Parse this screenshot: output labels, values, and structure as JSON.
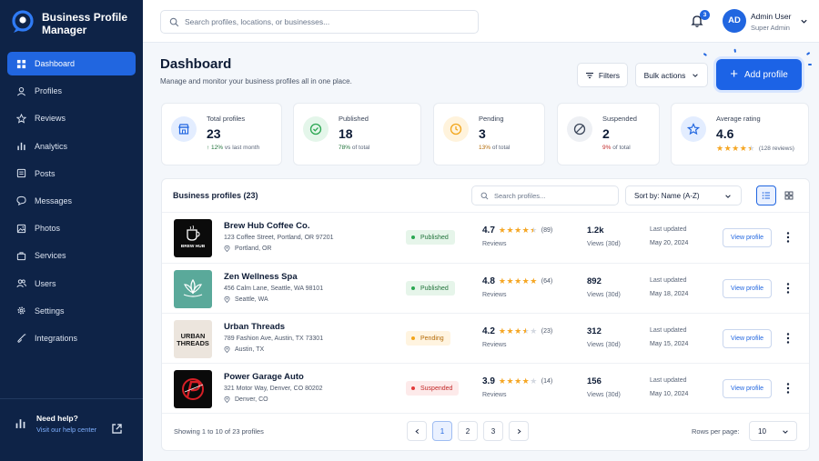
{
  "app": {
    "title": "Business Profile Manager"
  },
  "sidebar": {
    "items": [
      {
        "label": "Dashboard",
        "icon": "dashboard-icon",
        "active": true
      },
      {
        "label": "Profiles",
        "icon": "profiles-icon"
      },
      {
        "label": "Reviews",
        "icon": "star-icon"
      },
      {
        "label": "Analytics",
        "icon": "analytics-icon"
      },
      {
        "label": "Posts",
        "icon": "posts-icon"
      },
      {
        "label": "Messages",
        "icon": "messages-icon"
      },
      {
        "label": "Photos",
        "icon": "photos-icon"
      },
      {
        "label": "Services",
        "icon": "services-icon"
      },
      {
        "label": "Users",
        "icon": "users-icon"
      },
      {
        "label": "Settings",
        "icon": "settings-icon"
      },
      {
        "label": "Integrations",
        "icon": "integrations-icon"
      }
    ],
    "help": {
      "title": "Need help?",
      "link": "Visit our help center"
    }
  },
  "topbar": {
    "search_placeholder": "Search profiles, locations, or businesses...",
    "notifications_count": "3",
    "user": {
      "initials": "AD",
      "name": "Admin User",
      "role": "Super Admin"
    }
  },
  "header": {
    "title": "Dashboard",
    "subtitle": "Manage and monitor your business profiles all in one place.",
    "filters_label": "Filters",
    "bulk_label": "Bulk actions",
    "add_label": "Add profile"
  },
  "stats": {
    "total": {
      "label": "Total profiles",
      "value": "23",
      "change": "↑ 12%",
      "sub": "vs last month"
    },
    "published": {
      "label": "Published",
      "value": "18",
      "pct": "78%",
      "sub": "of total"
    },
    "pending": {
      "label": "Pending",
      "value": "3",
      "pct": "13%",
      "sub": "of total"
    },
    "suspended": {
      "label": "Suspended",
      "value": "2",
      "pct": "9%",
      "sub": "of total"
    },
    "rating": {
      "label": "Average rating",
      "value": "4.6",
      "count": "(128 reviews)",
      "stars": 4.5
    }
  },
  "table": {
    "title": "Business profiles (23)",
    "search_placeholder": "Search profiles...",
    "sort_label": "Sort by: Name (A-Z)",
    "rows": [
      {
        "name": "Brew Hub Coffee Co.",
        "address": "123 Coffee Street, Portland, OR 97201",
        "city": "Portland, OR",
        "status": "Published",
        "rating": "4.7",
        "stars": 4.5,
        "reviews_count": "(89)",
        "rating_label": "Reviews",
        "views": "1.2k",
        "views_label": "Views (30d)",
        "updated_label": "Last updated",
        "updated": "May 20, 2024",
        "action": "View profile",
        "logo": "brew-hub-logo",
        "logo_text": "BREW HUB"
      },
      {
        "name": "Zen Wellness Spa",
        "address": "456 Calm Lane, Seattle, WA 98101",
        "city": "Seattle, WA",
        "status": "Published",
        "rating": "4.8",
        "stars": 5,
        "reviews_count": "(64)",
        "rating_label": "Reviews",
        "views": "892",
        "views_label": "Views (30d)",
        "updated_label": "Last updated",
        "updated": "May 18, 2024",
        "action": "View profile",
        "logo": "lotus-logo"
      },
      {
        "name": "Urban Threads",
        "address": "789 Fashion Ave, Austin, TX 73301",
        "city": "Austin, TX",
        "status": "Pending",
        "rating": "4.2",
        "stars": 3.5,
        "reviews_count": "(23)",
        "rating_label": "Reviews",
        "views": "312",
        "views_label": "Views (30d)",
        "updated_label": "Last updated",
        "updated": "May 15, 2024",
        "action": "View profile",
        "logo": "urban-threads-logo",
        "logo_text": "URBAN THREADS"
      },
      {
        "name": "Power Garage Auto",
        "address": "321 Motor Way, Denver, CO 80202",
        "city": "Denver, CO",
        "status": "Suspended",
        "rating": "3.9",
        "stars": 4,
        "reviews_count": "(14)",
        "rating_label": "Reviews",
        "views": "156",
        "views_label": "Views (30d)",
        "updated_label": "Last updated",
        "updated": "May 10, 2024",
        "action": "View profile",
        "logo": "power-garage-logo"
      }
    ],
    "showing": "Showing 1 to 10 of 23 profiles",
    "pages": [
      "1",
      "2",
      "3"
    ],
    "rows_per_page_label": "Rows per page:",
    "rows_per_page": "10"
  },
  "colors": {
    "sidebar": "#0e2347",
    "accent": "#2166e0",
    "star": "#f5a623",
    "published": "#2aa651",
    "pending": "#f2a51a",
    "suspended": "#e23b3b"
  }
}
